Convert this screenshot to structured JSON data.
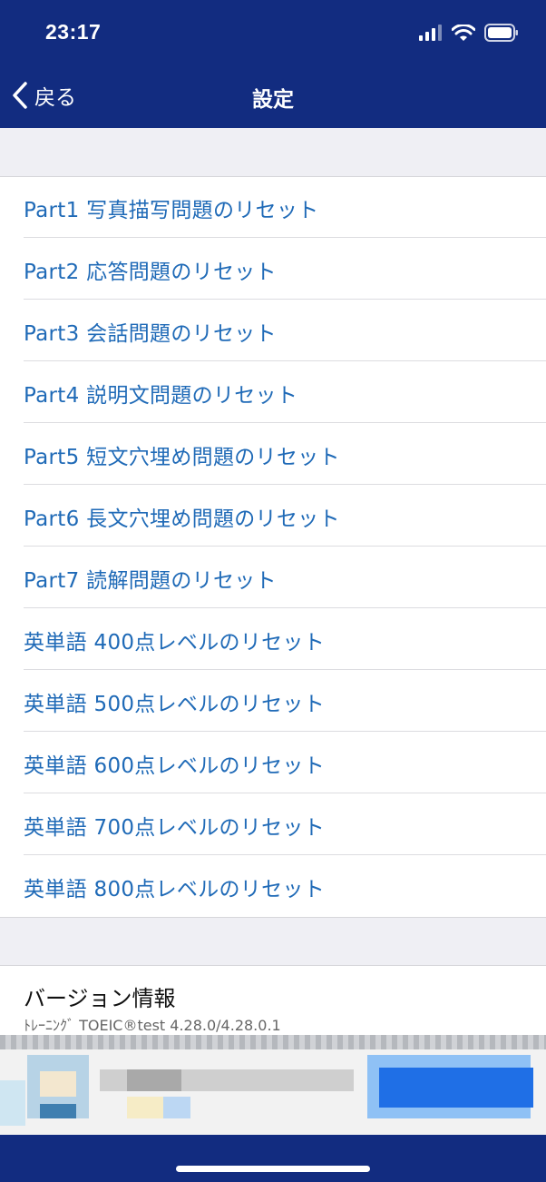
{
  "status_bar": {
    "time": "23:17"
  },
  "nav": {
    "back_label": "戻る",
    "title": "設定"
  },
  "reset_items": [
    "Part1 写真描写問題のリセット",
    "Part2 応答問題のリセット",
    "Part3 会話問題のリセット",
    "Part4 説明文問題のリセット",
    "Part5 短文穴埋め問題のリセット",
    "Part6 長文穴埋め問題のリセット",
    "Part7 読解問題のリセット",
    "英単語 400点レベルのリセット",
    "英単語 500点レベルのリセット",
    "英単語 600点レベルのリセット",
    "英単語 700点レベルのリセット",
    "英単語 800点レベルのリセット"
  ],
  "version": {
    "title": "バージョン情報",
    "subtitle": "ﾄﾚｰﾆﾝｸﾞ TOEIC®test 4.28.0/4.28.0.1"
  },
  "colors": {
    "header_bg": "#122c80",
    "link_text": "#1f6ab7",
    "page_bg": "#efeff4"
  }
}
